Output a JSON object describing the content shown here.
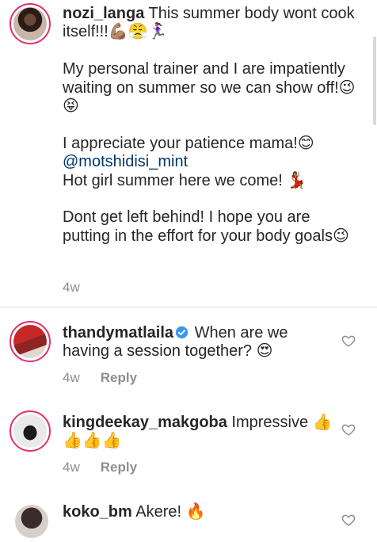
{
  "caption": {
    "username": "nozi_langa",
    "line1": " This summer body wont cook itself!!!💪🏽😤🏃🏽‍♀️",
    "para2": "My personal trainer and I are impatiently waiting on summer so we can show off!😉😝",
    "para3_line1": "I appreciate your patience mama!😊",
    "para3_mention": "@motshidisi_mint",
    "para3_line3": "Hot girl summer here we come! 💃🏽",
    "para4": "Dont get left behind! I hope you are putting in the effort for your body goals😉",
    "time": "4w"
  },
  "comments": [
    {
      "username": "thandymatlaila",
      "verified": true,
      "text": " When are we having a session together? 😍",
      "time": "4w",
      "reply_label": "Reply"
    },
    {
      "username": "kingdeekay_makgoba",
      "text": " Impressive 👍👍👍👍",
      "time": "4w",
      "reply_label": "Reply"
    },
    {
      "username": "koko_bm",
      "text": " Akere! 🔥"
    }
  ],
  "colors": {
    "accent_ring": "#e1306c",
    "verified_blue": "#3897f0",
    "mention": "#00376b"
  }
}
